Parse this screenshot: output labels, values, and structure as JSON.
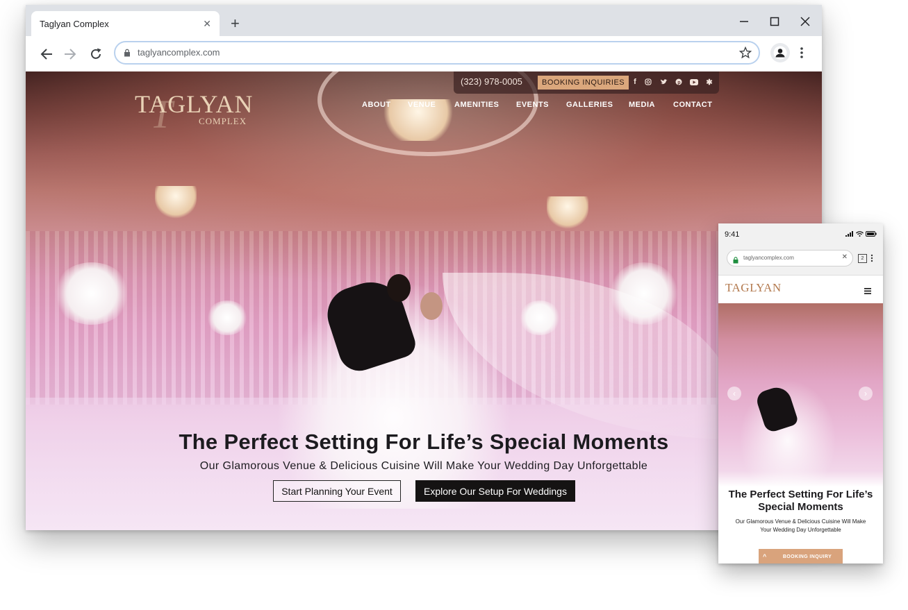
{
  "browser": {
    "tab_title": "Taglyan Complex",
    "url": "taglyancomplex.com"
  },
  "site": {
    "logo_main": "TAGLYAN",
    "logo_sub": "COMPLEX",
    "phone": "(323) 978-0005",
    "booking_label": "BOOKING INQUIRIES",
    "social_icons": [
      "facebook-icon",
      "instagram-icon",
      "twitter-icon",
      "pinterest-icon",
      "youtube-icon",
      "yelp-icon"
    ],
    "nav": [
      "ABOUT",
      "VENUE",
      "AMENITIES",
      "EVENTS",
      "GALLERIES",
      "MEDIA",
      "CONTACT"
    ],
    "headline": "The Perfect Setting For Life’s Special Moments",
    "subheadline": "Our Glamorous Venue & Delicious Cuisine Will Make Your Wedding Day Unforgettable",
    "cta_primary": "Start Planning Your Event",
    "cta_secondary": "Explore Our Setup For Weddings"
  },
  "mobile": {
    "time": "9:41",
    "url": "taglyancomplex.com",
    "tab_count": "2",
    "logo": "TAGLYAN",
    "headline_line1": "The Perfect Setting For Life’s",
    "headline_line2": "Special Moments",
    "sub_line1": "Our Glamorous Venue & Delicious Cuisine Will Make",
    "sub_line2": "Your Wedding Day Unforgettable",
    "booking_label": "BOOKING INQUIRY"
  },
  "colors": {
    "accent_gold": "#dba77c",
    "button_dark": "#151313",
    "hero_pink": "#e6a9cb"
  }
}
